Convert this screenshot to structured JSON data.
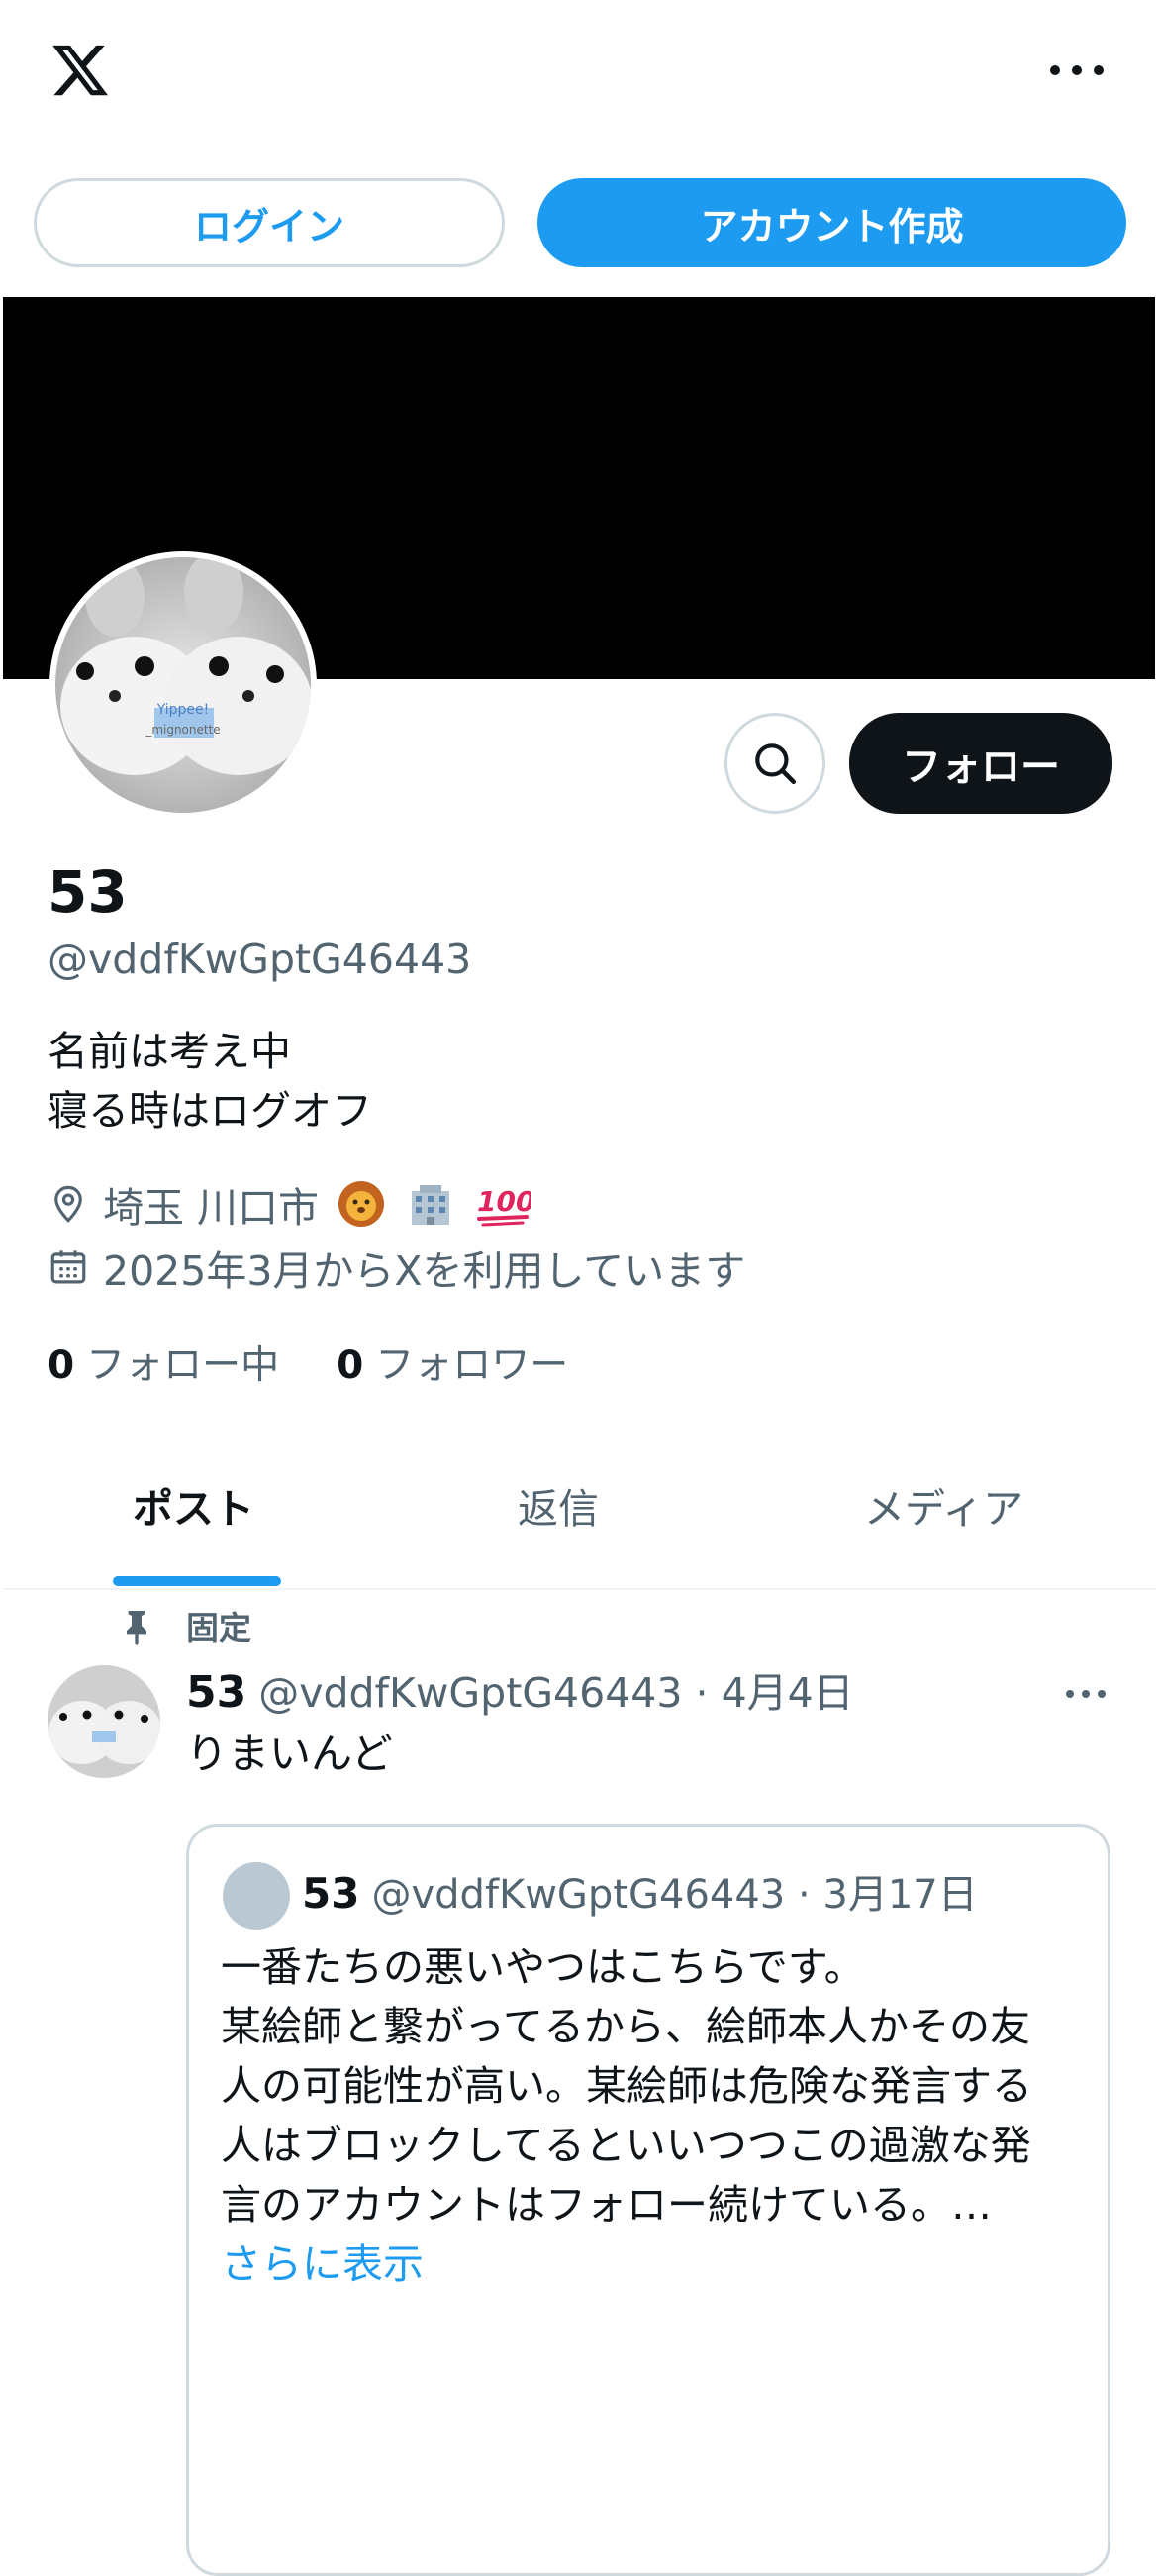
{
  "header": {
    "logo": "x-logo-icon",
    "more_icon": "more-horizontal-icon"
  },
  "auth": {
    "login_label": "ログイン",
    "signup_label": "アカウント作成"
  },
  "colors": {
    "accent": "#1d9bf0",
    "text": "#0f1419",
    "secondary_text": "#536471",
    "border": "#cfd9de",
    "banner": "#000000"
  },
  "profile": {
    "display_name": "53",
    "handle": "@vddfKwGptG46443",
    "avatar_caption_top": "Yippee!",
    "avatar_caption_bottom": "_mignonette",
    "bio_lines": [
      "名前は考え中",
      "寝る時はログオフ"
    ],
    "location": "埼玉 川口市",
    "location_emoji": [
      "lion-emoji",
      "office-building-emoji",
      "hundred-points-emoji"
    ],
    "joined": "2025年3月からXを利用しています",
    "following_count": "0",
    "following_label": "フォロー中",
    "followers_count": "0",
    "followers_label": "フォロワー",
    "follow_label": "フォロー"
  },
  "tabs": [
    {
      "label": "ポスト",
      "active": true
    },
    {
      "label": "返信",
      "active": false
    },
    {
      "label": "メディア",
      "active": false
    }
  ],
  "pinned_post": {
    "pinned_label": "固定",
    "author_name": "53",
    "author_handle": "@vddfKwGptG46443",
    "date": "· 4月4日",
    "text": "りまいんど",
    "quote": {
      "author_name": "53",
      "author_handle": "@vddfKwGptG46443",
      "date": "· 3月17日",
      "lines": [
        "一番たちの悪いやつはこちらです。",
        "某絵師と繋がってるから、絵師本人かその友",
        "人の可能性が高い。某絵師は危険な発言する",
        "人はブロックしてるといいつつこの過激な発",
        "言のアカウントはフォロー続けている。…"
      ],
      "show_more": "さらに表示"
    }
  }
}
